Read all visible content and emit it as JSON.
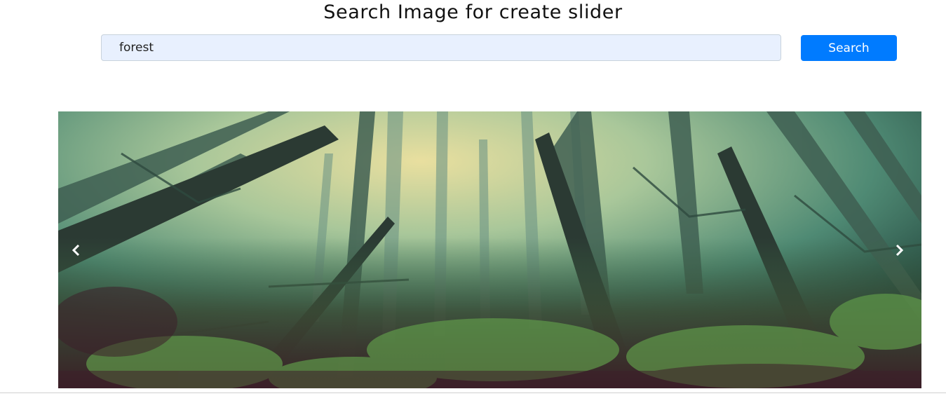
{
  "header": {
    "title": "Search Image for create slider"
  },
  "search": {
    "value": "forest",
    "button_label": "Search"
  },
  "slider": {
    "prev_icon": "chevron-left-icon",
    "next_icon": "chevron-right-icon"
  },
  "colors": {
    "accent": "#007bff",
    "input_bg": "#e8f0fe"
  }
}
